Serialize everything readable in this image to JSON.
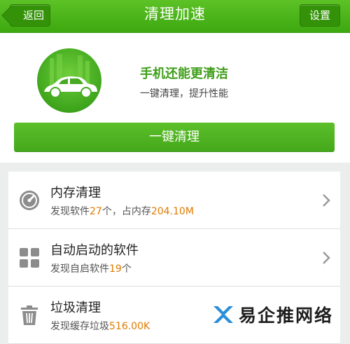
{
  "topbar": {
    "back_label": "返回",
    "title": "清理加速",
    "settings_label": "设置"
  },
  "hero": {
    "headline": "手机还能更清洁",
    "subline": "一键清理，提升性能",
    "clean_button": "一键清理"
  },
  "rows": [
    {
      "title": "内存清理",
      "icon": "speedometer-icon",
      "desc_prefix": "发现软件",
      "desc_num1": "27",
      "desc_mid": "个，占内存",
      "desc_num2": "204.10M"
    },
    {
      "title": "自动启动的软件",
      "icon": "apps-grid-icon",
      "desc_prefix": "发现自启软件",
      "desc_num1": "19",
      "desc_mid": "个"
    },
    {
      "title": "垃圾清理",
      "icon": "trash-icon",
      "desc_prefix": "发现缓存垃圾",
      "desc_num1": "516.00K"
    }
  ],
  "watermark": {
    "text": "易企推网络"
  },
  "colors": {
    "brand_green": "#44a81b",
    "highlight_orange": "#e07b00"
  }
}
